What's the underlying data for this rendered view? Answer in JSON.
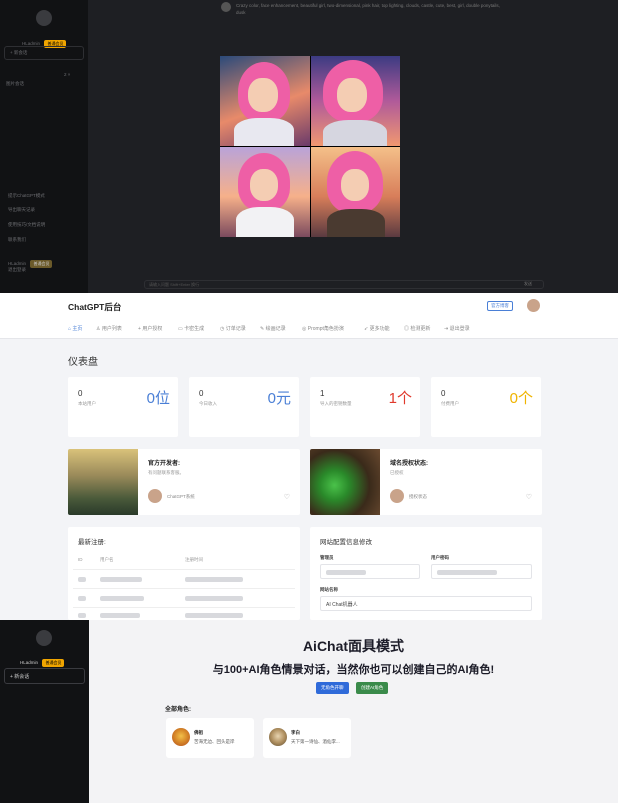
{
  "chat_app": {
    "user_name": "HLadmin",
    "user_badge": "普通会员",
    "new_chat_label": "+ 新会话",
    "conversation_item": "图片会话",
    "conversation_counts": "2  ×",
    "sidebar_footer": [
      "提示ChatGPT模式",
      "导出聊天记录",
      "使用技巧/文档说明",
      "联系我们",
      "HLadmin",
      "退出登录"
    ],
    "footer_badge": "普通会员",
    "prompt_text": "Crazy color, face enhancement, beautiful girl, two-dimensional, pink hair, top lighting, clouds, castle, cute, best, girl, double ponytails, dusk",
    "input_placeholder": "请输入问题 Shift+Enter 换行",
    "send_label": "发送"
  },
  "admin": {
    "title": "ChatGPT后台",
    "official_button": "官方博客",
    "nav": [
      "主页",
      "用户列表",
      "用户授权",
      "卡密生成",
      "订单记录",
      "绘画记录",
      "Prompt角色扮演",
      "更多功能",
      "检测更新",
      "退出登录"
    ],
    "dashboard_title": "仪表盘",
    "stats": [
      {
        "value": "0",
        "label": "本站用户",
        "big": "0位",
        "color": "#4a7fd6"
      },
      {
        "value": "0",
        "label": "今日收入",
        "big": "0元",
        "color": "#4a7fd6"
      },
      {
        "value": "1",
        "label": "导入的密钥数量",
        "big": "1个",
        "color": "#e0392c"
      },
      {
        "value": "0",
        "label": "付费用户",
        "big": "0个",
        "color": "#f0b400"
      }
    ],
    "developer_card": {
      "title": "官方开发者:",
      "subtitle": "有问题联系客服。",
      "name": "ChatGPT系统"
    },
    "domain_card": {
      "title": "域名授权状态:",
      "subtitle": "已授权",
      "name": "授权状态"
    },
    "latest_title": "最新注册:",
    "latest_columns": [
      "ID",
      "用户名",
      "注册时间"
    ],
    "config_title": "网站配置信息修改",
    "config_admin_label": "管理员",
    "config_password_label": "用户密码",
    "config_site_label": "网站名称",
    "config_site_value": "AI Chat机器人"
  },
  "aichat": {
    "user_name": "HLadmin",
    "user_badge": "普通会员",
    "new_chat_label": "+ 新会话",
    "title": "AiChat面具模式",
    "subtitle": "与100+AI角色情景对话，当然你也可以创建自己的AI角色!",
    "btn_generate": "无角色开聊",
    "btn_create": "创建AI角色",
    "all_roles_label": "全部角色:",
    "roles": [
      {
        "name": "佛祖",
        "desc": "苦海无边、回头是岸"
      },
      {
        "name": "李白",
        "desc": "天下第一诗仙、酒仙李..."
      }
    ]
  }
}
